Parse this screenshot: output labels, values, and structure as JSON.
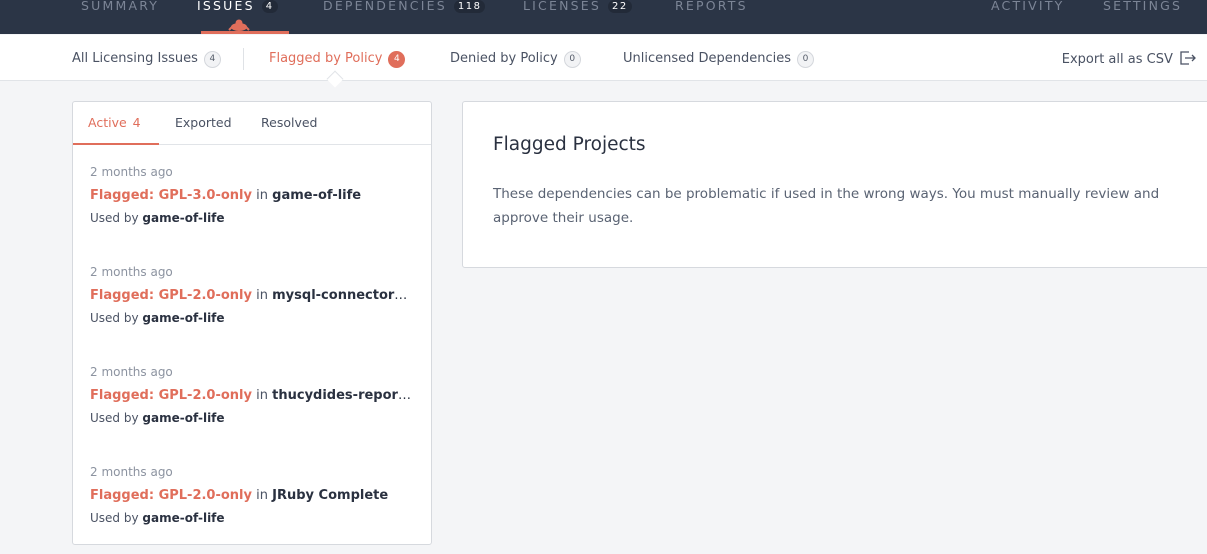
{
  "topnav": {
    "items": [
      {
        "label": "SUMMARY",
        "count": null
      },
      {
        "label": "ISSUES",
        "count": "4"
      },
      {
        "label": "DEPENDENCIES",
        "count": "118"
      },
      {
        "label": "LICENSES",
        "count": "22"
      },
      {
        "label": "REPORTS",
        "count": null
      },
      {
        "label": "ACTIVITY",
        "count": null
      },
      {
        "label": "SETTINGS",
        "count": null
      }
    ],
    "active": "ISSUES",
    "accent_color": "#e06e5b"
  },
  "subnav": {
    "tabs": [
      {
        "label": "All Licensing Issues",
        "count": "4"
      },
      {
        "label": "Flagged by Policy",
        "count": "4"
      },
      {
        "label": "Denied by Policy",
        "count": "0"
      },
      {
        "label": "Unlicensed Dependencies",
        "count": "0"
      }
    ],
    "active": "Flagged by Policy",
    "export_label": "Export all as CSV",
    "export_icon": "export-icon"
  },
  "left": {
    "tabs": [
      {
        "label": "Active",
        "count": "4"
      },
      {
        "label": "Exported",
        "count": null
      },
      {
        "label": "Resolved",
        "count": null
      }
    ],
    "issues": [
      {
        "time": "2 months ago",
        "flag": "Flagged: GPL-3.0-only",
        "in": "in",
        "target": "game-of-life",
        "used_prefix": "Used by",
        "used_by": "game-of-life"
      },
      {
        "time": "2 months ago",
        "flag": "Flagged: GPL-2.0-only",
        "in": "in",
        "target": "mysql-connector-j...",
        "used_prefix": "Used by",
        "used_by": "game-of-life"
      },
      {
        "time": "2 months ago",
        "flag": "Flagged: GPL-2.0-only",
        "in": "in",
        "target": "thucydides-report-...",
        "used_prefix": "Used by",
        "used_by": "game-of-life"
      },
      {
        "time": "2 months ago",
        "flag": "Flagged: GPL-2.0-only",
        "in": "in",
        "target": "JRuby Complete",
        "used_prefix": "Used by",
        "used_by": "game-of-life"
      }
    ]
  },
  "right": {
    "title": "Flagged Projects",
    "description": "These dependencies can be problematic if used in the wrong ways. You must manually review and approve their usage."
  }
}
